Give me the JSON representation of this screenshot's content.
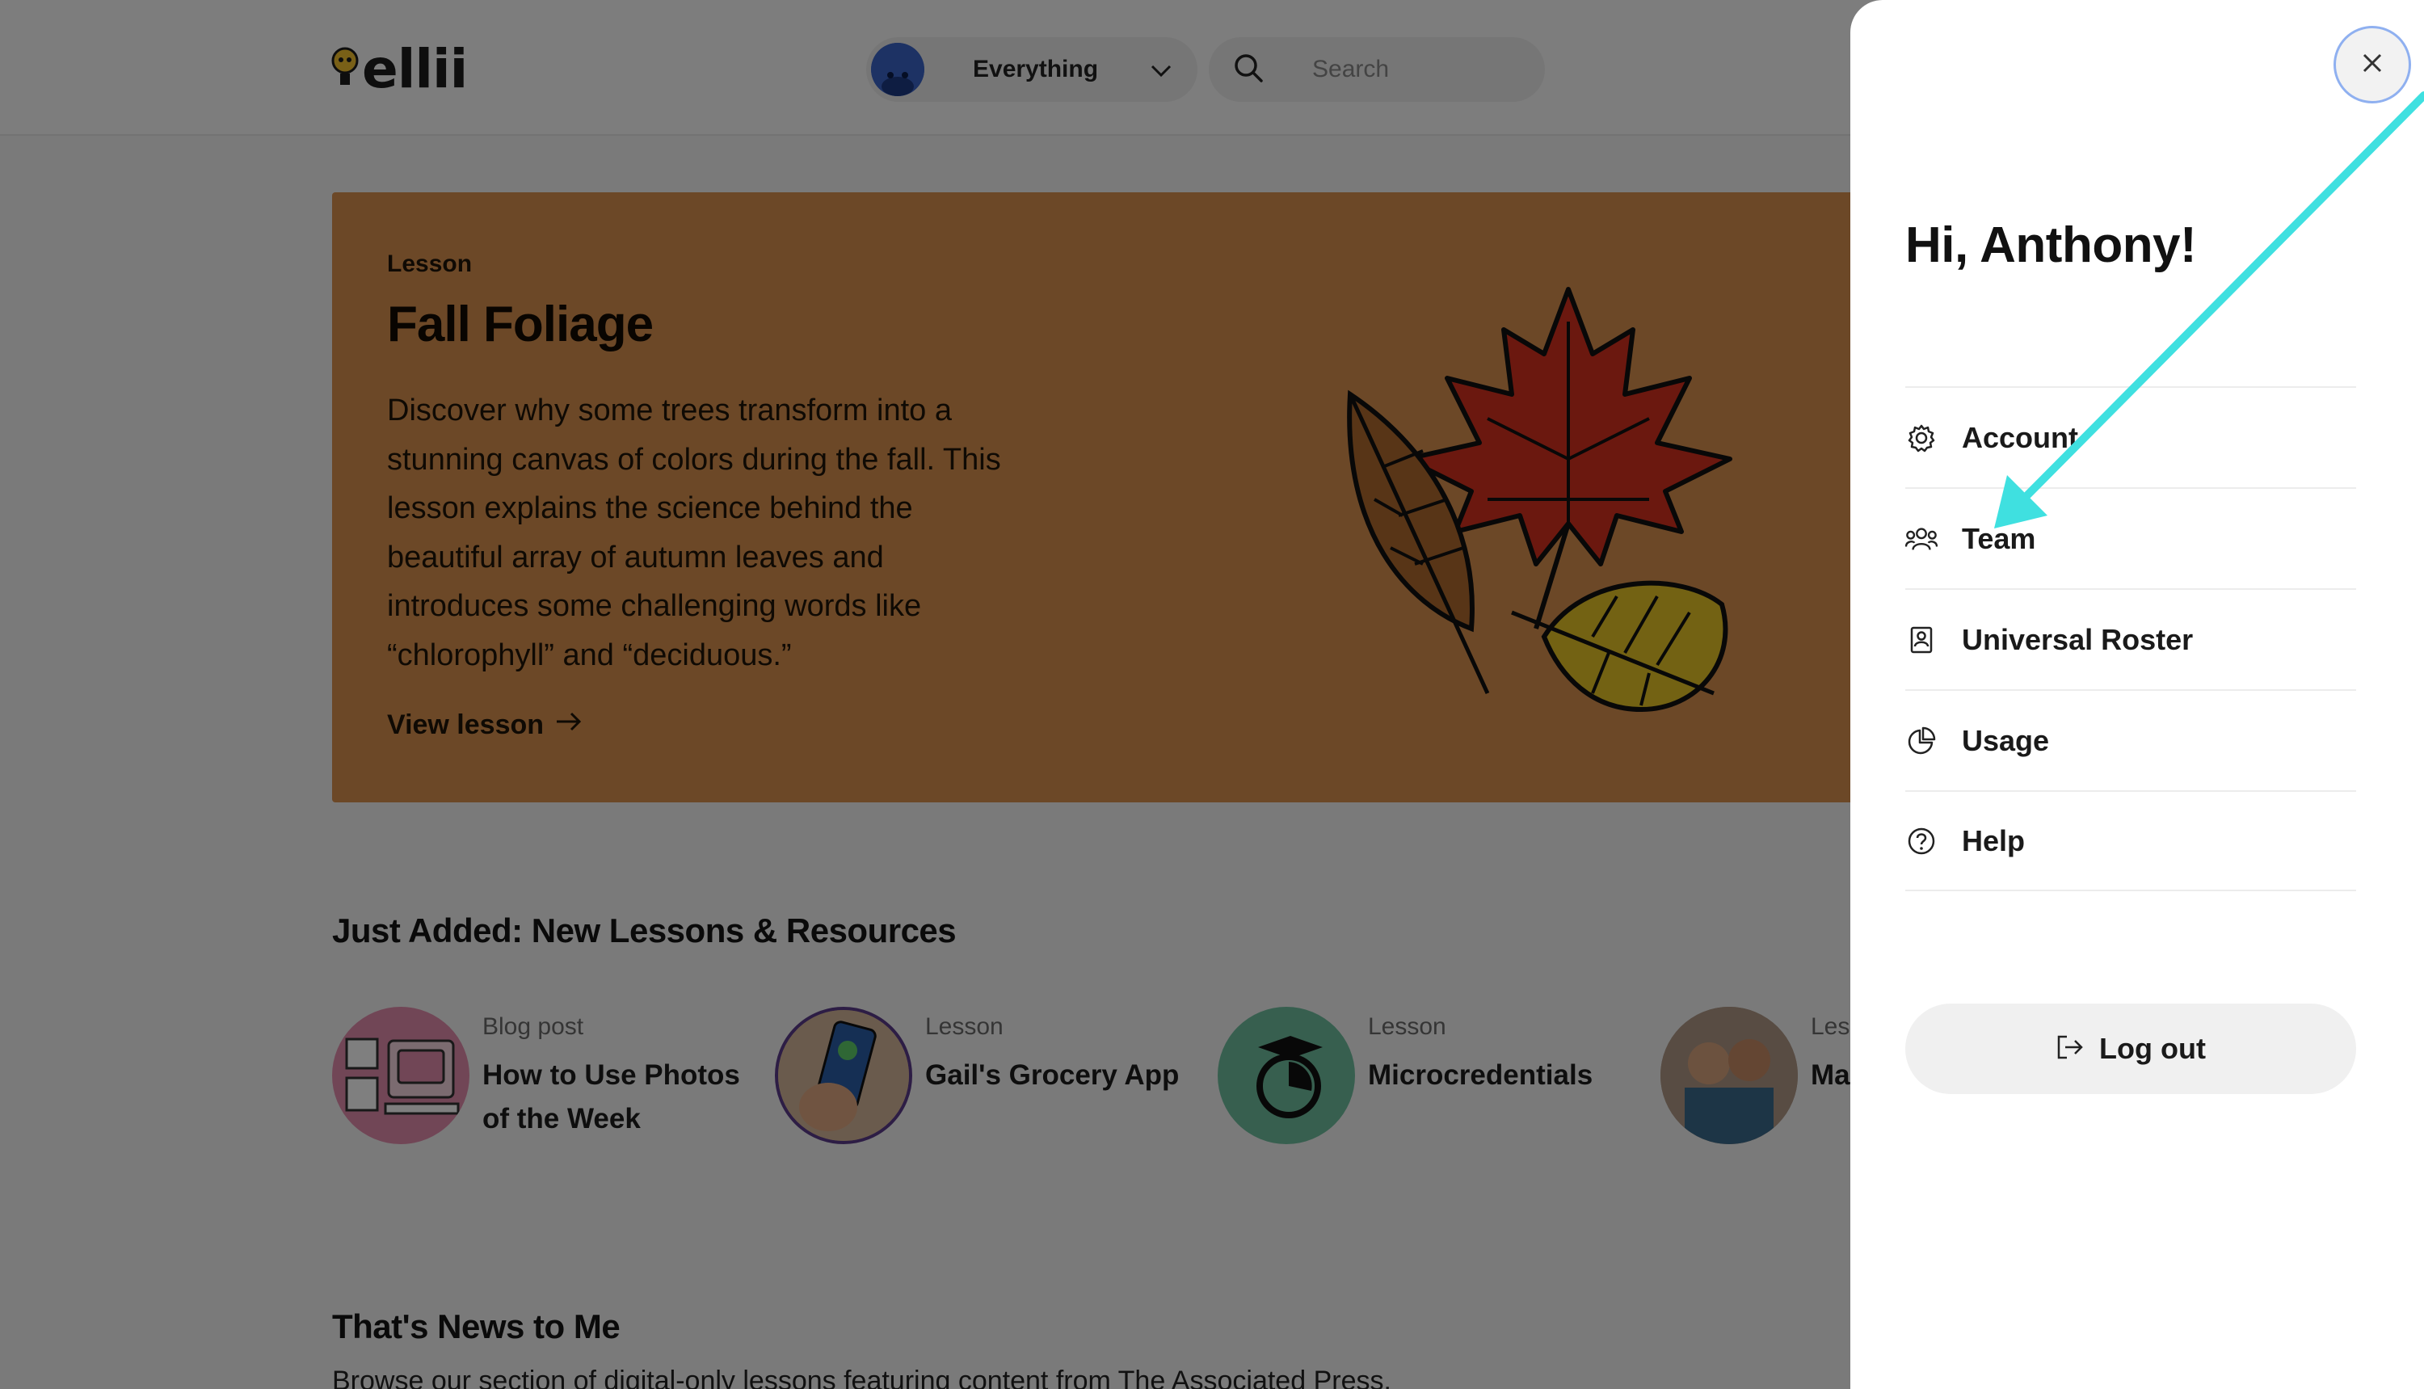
{
  "header": {
    "logo_text": "ellii",
    "filter_label": "Everything",
    "search_placeholder": "Search"
  },
  "hero": {
    "type_label": "Lesson",
    "title": "Fall Foliage",
    "description": "Discover why some trees transform into a stunning canvas of colors during the fall. This lesson explains the science behind the beautiful array of autumn leaves and introduces some challenging words like “chlorophyll” and “deciduous.”",
    "link_label": "View lesson"
  },
  "just_added": {
    "title": "Just Added: New Lessons & Resources",
    "cards": [
      {
        "type": "Blog post",
        "title": "How to Use Photos of the Week"
      },
      {
        "type": "Lesson",
        "title": "Gail's Grocery App"
      },
      {
        "type": "Lesson",
        "title": "Microcredentials"
      },
      {
        "type": "Less",
        "title": "Ma"
      }
    ]
  },
  "news": {
    "title": "That's News to Me",
    "description": "Browse our section of digital-only lessons featuring content from The Associated Press."
  },
  "drawer": {
    "greeting": "Hi, Anthony!",
    "menu": [
      {
        "label": "Account",
        "icon": "gear-icon"
      },
      {
        "label": "Team",
        "icon": "team-icon"
      },
      {
        "label": "Universal Roster",
        "icon": "roster-icon"
      },
      {
        "label": "Usage",
        "icon": "pie-chart-icon"
      },
      {
        "label": "Help",
        "icon": "help-icon"
      }
    ],
    "logout_label": "Log out",
    "close_icon": "close-icon"
  },
  "colors": {
    "hero_bg": "#d9914f",
    "overlay": "rgba(0,0,0,0.5)",
    "annotation_arrow": "#3fe0e0",
    "close_ring": "#8fb0f0"
  }
}
